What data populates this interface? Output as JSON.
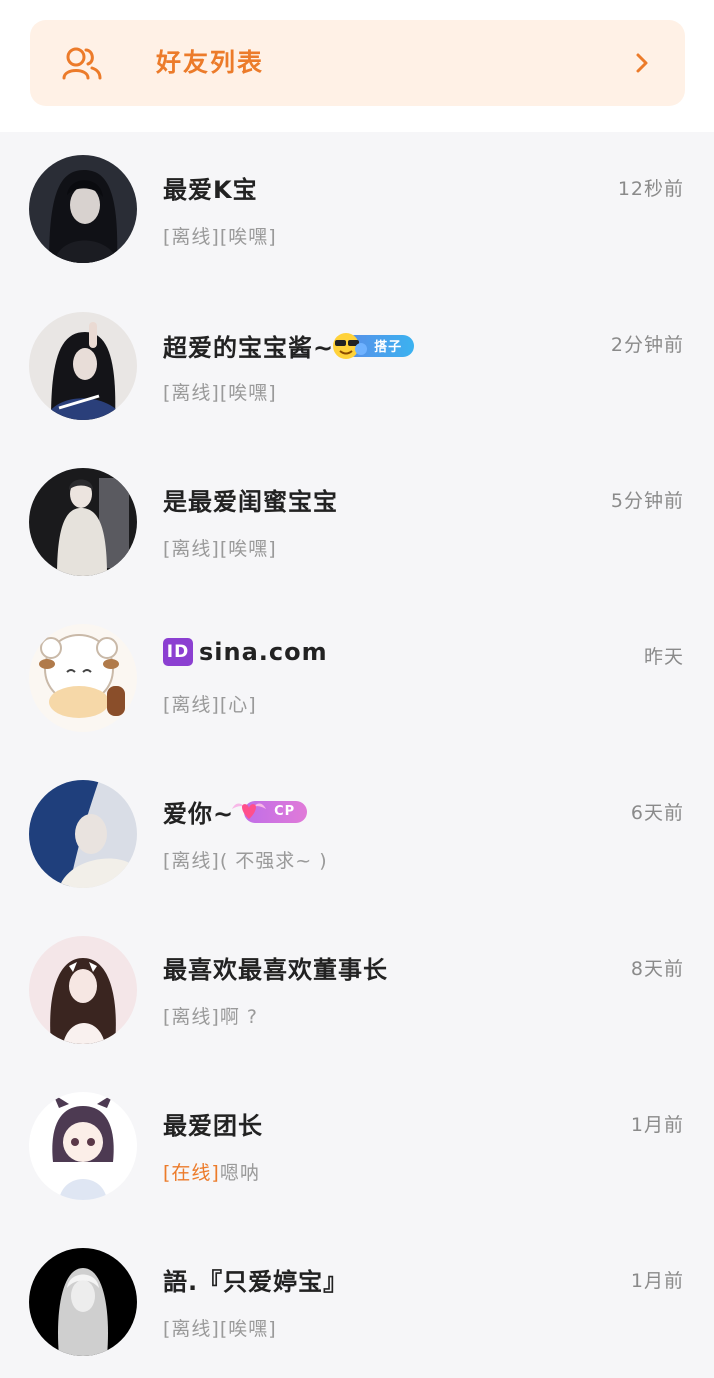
{
  "header": {
    "title": "好友列表"
  },
  "friends": [
    {
      "name": "最爱K宝",
      "time": "12秒前",
      "status": "[离线]",
      "message": "[唉嘿]"
    },
    {
      "name": "超爱的宝宝酱~",
      "badge": "搭子",
      "time": "2分钟前",
      "status": "[离线]",
      "message": "[唉嘿]"
    },
    {
      "name": "是最爱闺蜜宝宝",
      "time": "5分钟前",
      "status": "[离线]",
      "message": "[唉嘿]"
    },
    {
      "name": "sina.com",
      "id_label": "ID",
      "time": "昨天",
      "status": "[离线]",
      "message": "[心]"
    },
    {
      "name": "爱你~",
      "badge": "CP",
      "time": "6天前",
      "status": "[离线]",
      "message": "( 不强求~ )"
    },
    {
      "name": "最喜欢最喜欢董事长",
      "time": "8天前",
      "status": "[离线]",
      "message": "啊 ?"
    },
    {
      "name": "最爱团长",
      "time": "1月前",
      "status": "[在线]",
      "message": "嗯呐"
    },
    {
      "name": "語.『只爱婷宝』",
      "time": "1月前",
      "status": "[离线]",
      "message": "[唉嘿]"
    }
  ],
  "colors": {
    "accent": "#ec7b2a",
    "banner_bg": "#fff1e6"
  }
}
